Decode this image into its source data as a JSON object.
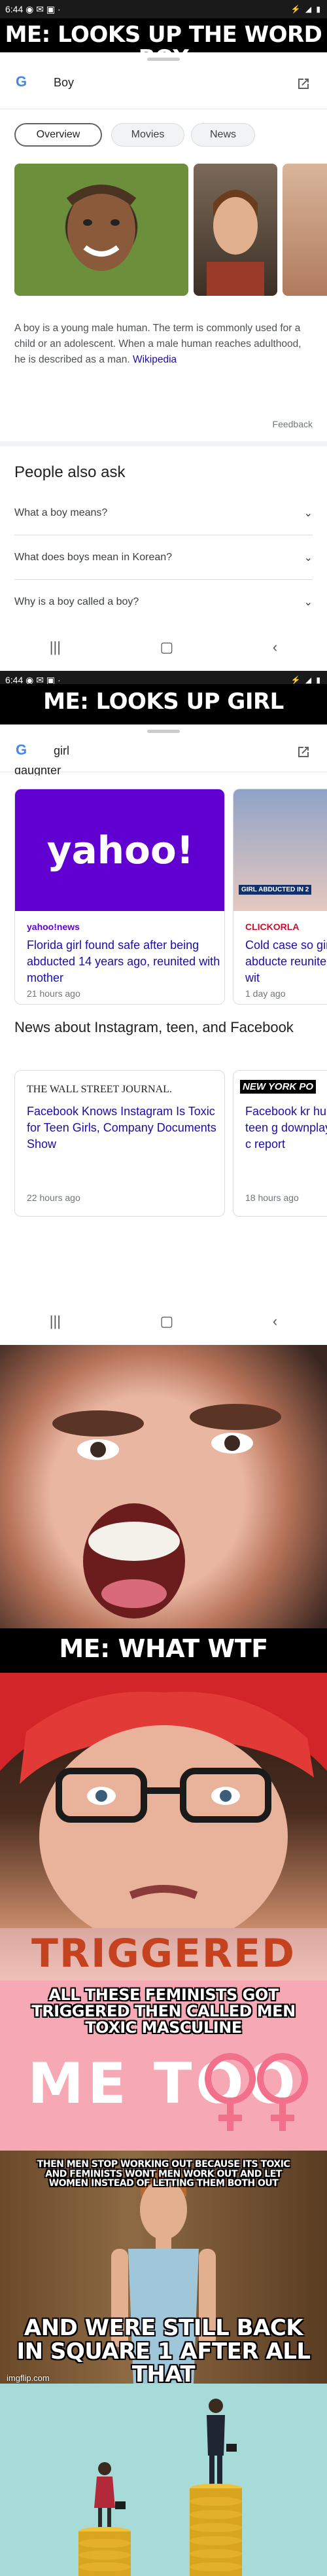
{
  "captions": {
    "top1": "ME: LOOKS UP THE WORD BOY",
    "top2": "ME: LOOKS UP GIRL",
    "what": "ME: WHAT WTF",
    "triggered": "TRIGGERED",
    "feminists": "ALL THESE FEMINISTS GOT TRIGGERED THEN CALLED MEN TOXIC MASCULINE",
    "metoo": "ME TOO",
    "workout": "THEN MEN STOP WORKING OUT BECAUSE ITS TOXIC AND FEMINISTS WONT MEN WORK OUT AND LET WOMEN INSTEAD OF LETTING THEM BOTH OUT",
    "square": "AND WERE STILL BACK IN SQUARE 1 AFTER ALL THAT",
    "watermark": "imgflip.com"
  },
  "screen1": {
    "time": "6:44",
    "status_icons": "◉ ✉ ▣ ·",
    "status_right": "⚡ ◢ ▮",
    "google_letter": "G",
    "query": "Boy",
    "tabs": [
      "Overview",
      "Movies",
      "News"
    ],
    "description": "A boy is a young male human. The term is commonly used for a child or an adolescent. When a male human reaches adulthood, he is described as a man.",
    "link": "Wikipedia",
    "feedback": "Feedback",
    "paa_title": "People also ask",
    "paa": [
      "What a boy means?",
      "What does boys mean in Korean?",
      "Why is a boy called a boy?"
    ]
  },
  "screen2": {
    "time": "6:44",
    "status_icons": "◉ ✉ ▣ ·",
    "status_right": "⚡ ◢ ▮",
    "google_letter": "G",
    "query": "girl",
    "partial_top": "daughter",
    "card1": {
      "logo": "yahoo!",
      "source": "yahoo!news",
      "title": "Florida girl found safe after being abducted 14 years ago, reunited with mother",
      "time": "21 hours ago"
    },
    "card2": {
      "source": "CLICKORLA",
      "title": "Cold case so girl abducte reunited wit",
      "time": "1 day ago",
      "banner": "GIRL ABDUCTED IN 2"
    },
    "news_title": "News about Instagram, teen, and Facebook",
    "card3": {
      "source": "THE WALL STREET JOURNAL.",
      "title": "Facebook Knows Instagram Is Toxic for Teen Girls, Company Documents Show",
      "time": "22 hours ago"
    },
    "card4": {
      "source": "NEW YORK PO",
      "title": "Facebook kr hurts teen g downplays c report",
      "time": "18 hours ago"
    }
  },
  "colors": {
    "pink": "#f6a9b5",
    "venus_pink": "#f2708a",
    "teal": "#a6dbd8",
    "coin_gold": "#d9a521"
  }
}
